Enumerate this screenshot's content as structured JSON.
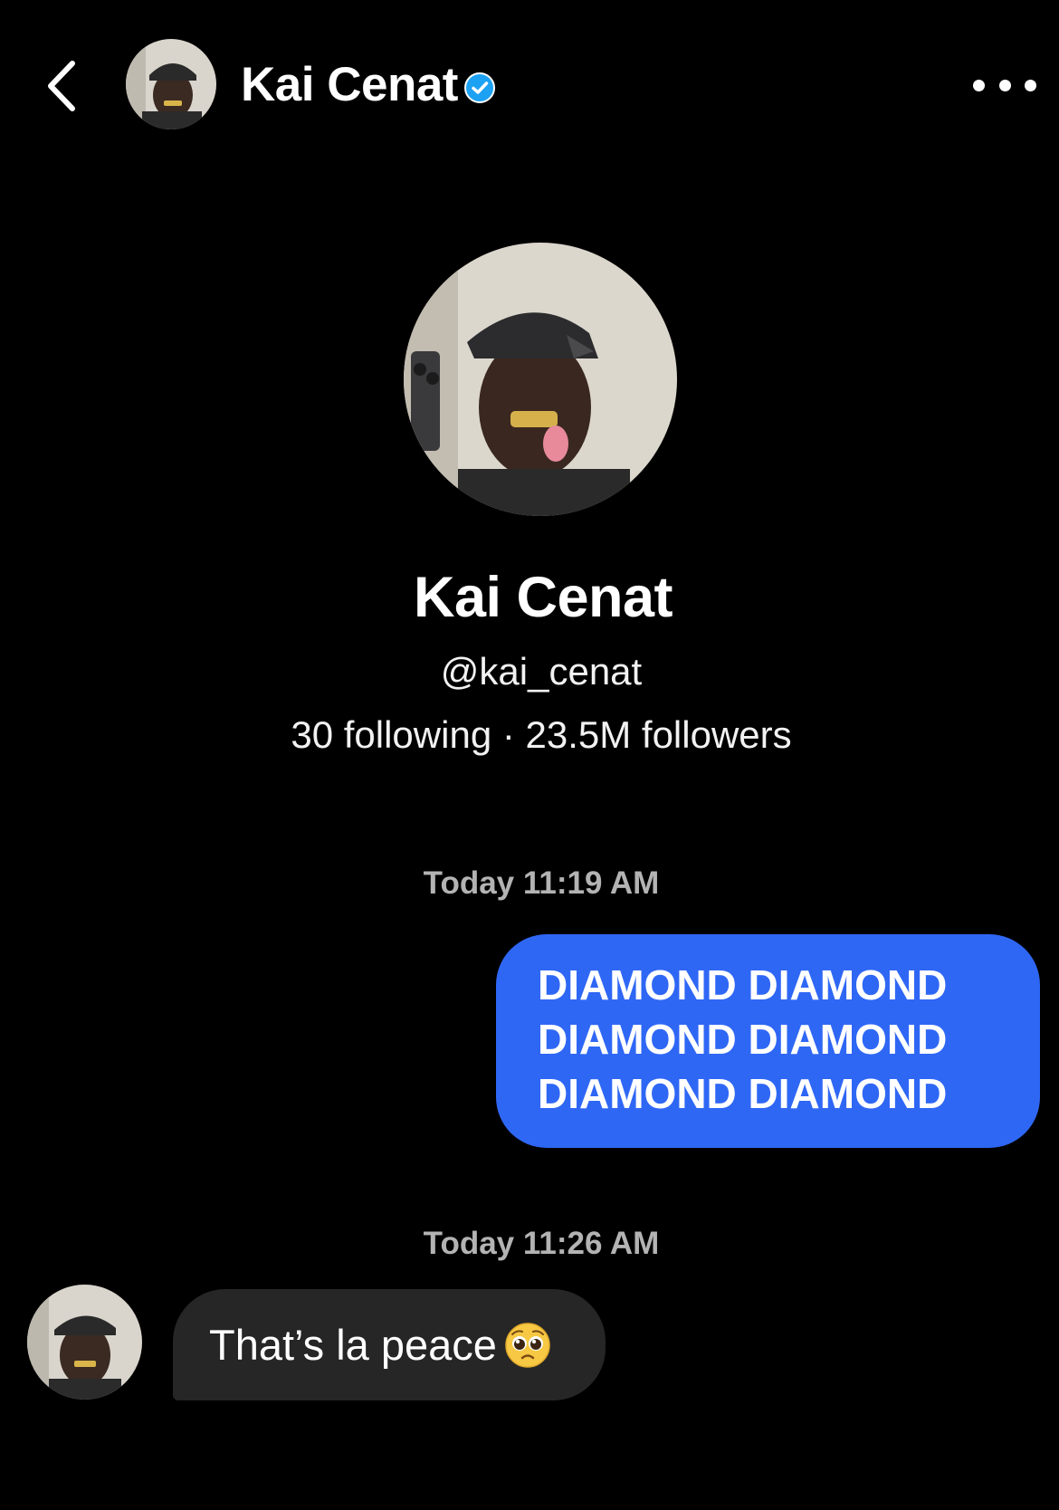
{
  "header": {
    "back_icon": "chevron-left-icon",
    "name": "Kai Cenat",
    "verified_icon": "verified-badge-icon",
    "more_icon": "more-horizontal-icon"
  },
  "profile": {
    "name": "Kai Cenat",
    "handle": "@kai_cenat",
    "stats": "30 following · 23.5M followers"
  },
  "messages": {
    "timestamp_1": "Today 11:19 AM",
    "outgoing_lines": [
      "DIAMOND DIAMOND",
      "DIAMOND DIAMOND",
      "DIAMOND DIAMOND"
    ],
    "timestamp_2": "Today 11:26 AM",
    "incoming_text": "That’s la peace",
    "incoming_emoji_icon": "pleading-face-icon"
  },
  "colors": {
    "background": "#000000",
    "outgoing_bubble": "#2f67f5",
    "incoming_bubble": "#262626",
    "verified": "#1da1f2"
  }
}
